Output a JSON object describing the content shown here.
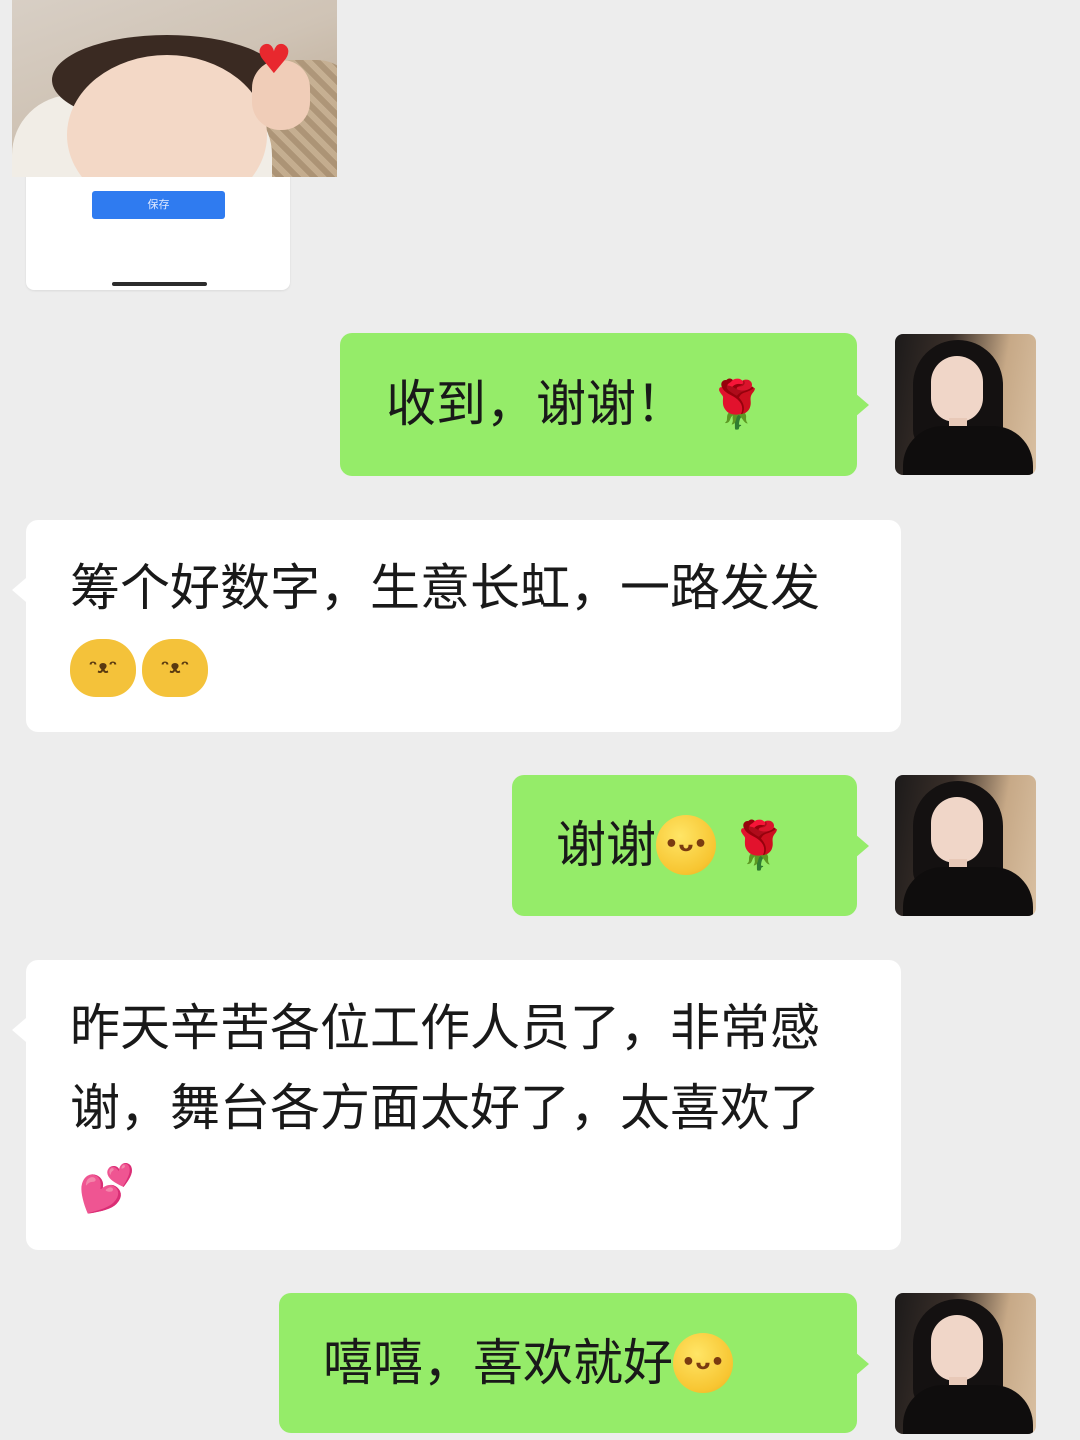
{
  "shared_card": {
    "button_label": "保存"
  },
  "messages": [
    {
      "side": "sent",
      "text": "收到，谢谢！",
      "emoji": [
        "rose-icon"
      ]
    },
    {
      "side": "received",
      "text": "筹个好数字，生意长虹，一路发发",
      "emoji": [
        "doge-icon",
        "doge-icon"
      ]
    },
    {
      "side": "sent",
      "text": "谢谢",
      "emoji": [
        "wink-tongue-icon",
        "rose-icon"
      ]
    },
    {
      "side": "received",
      "text": "昨天辛苦各位工作人员了，非常感谢，舞台各方面太好了，太喜欢了",
      "emoji": [
        "two-hearts-icon"
      ]
    },
    {
      "side": "sent",
      "text": "嘻嘻，喜欢就好",
      "emoji": [
        "wink-tongue-icon"
      ]
    }
  ],
  "glyphs": {
    "rose": "🌹",
    "hearts": "💕",
    "wink": "•ᴗ•",
    "doge": "ᵔᴥᵔ"
  },
  "colors": {
    "background": "#ededed",
    "sent_bubble": "#95ec69",
    "received_bubble": "#ffffff",
    "share_button": "#2f7bf0"
  }
}
